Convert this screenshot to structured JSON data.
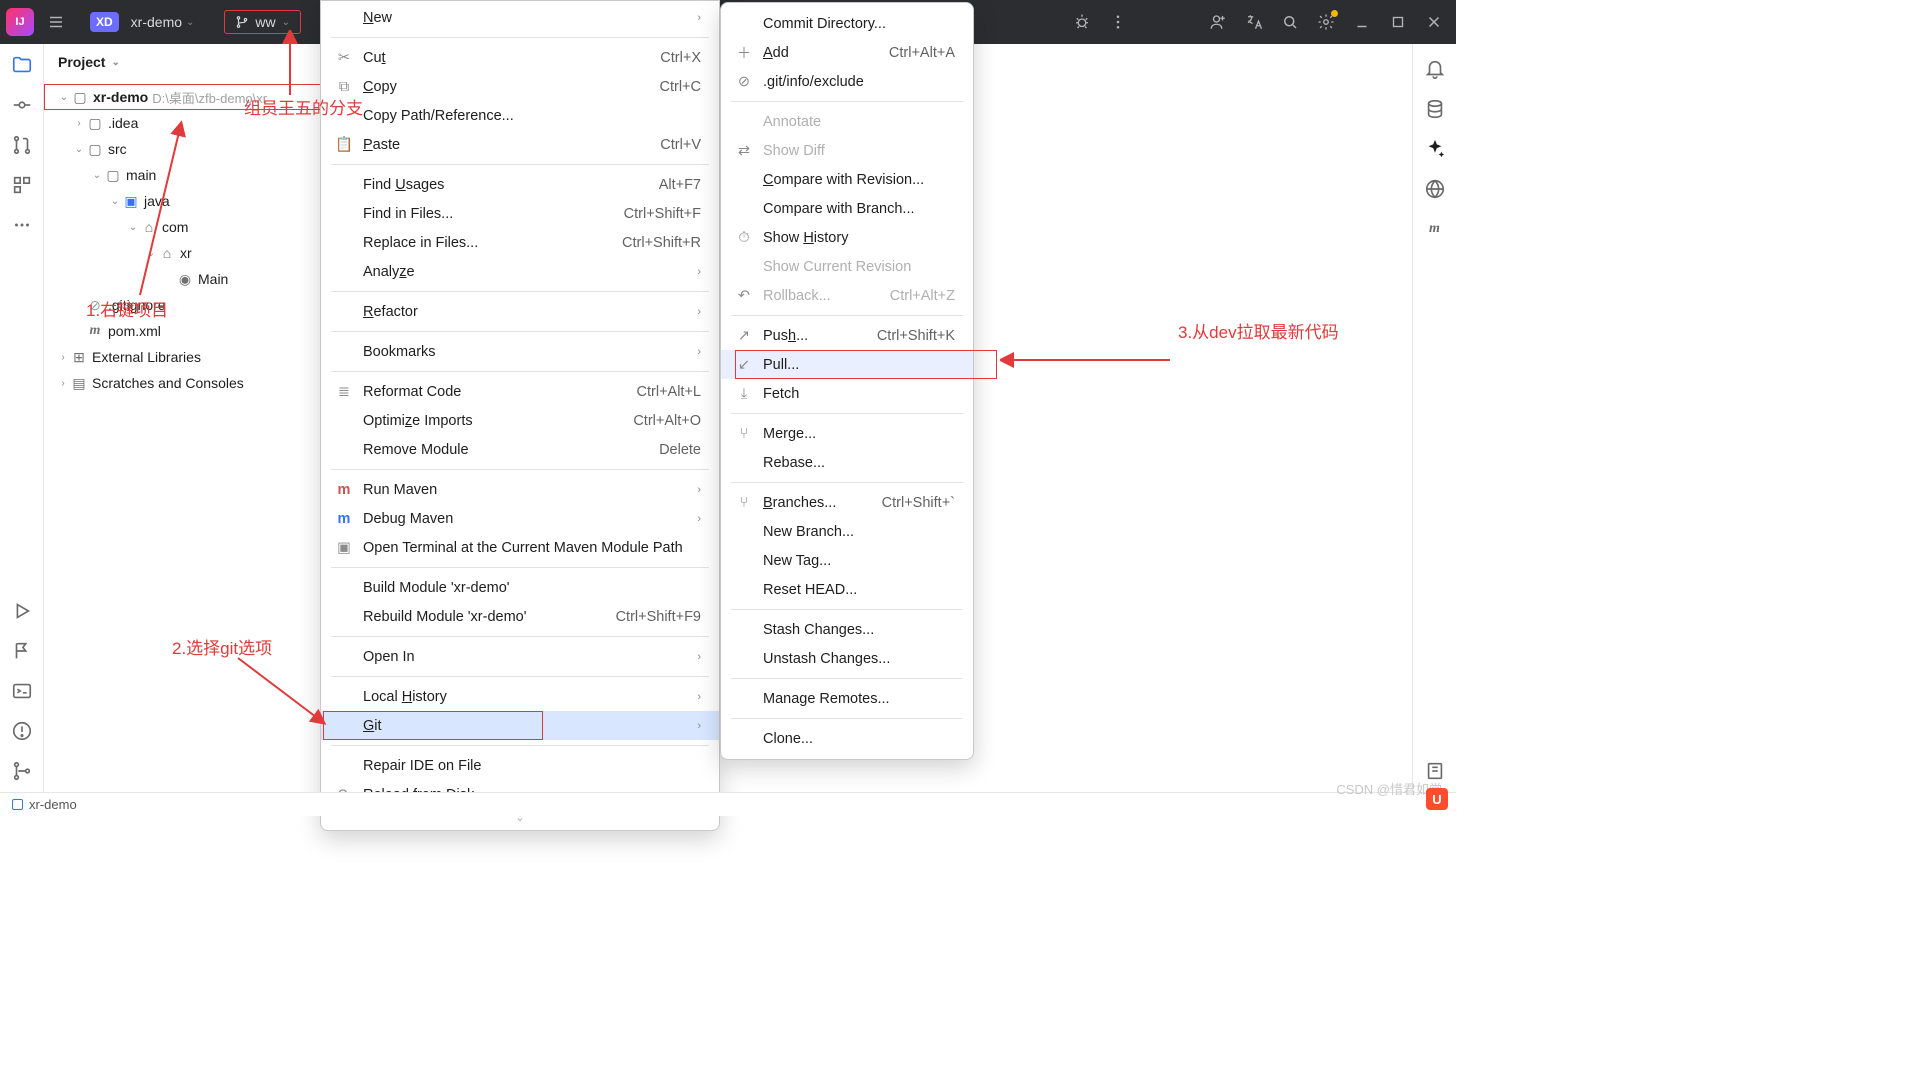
{
  "titlebar": {
    "project_badge": "XD",
    "project_name": "xr-demo",
    "branch_name": "ww"
  },
  "projpanel": {
    "title": "Project"
  },
  "tree": {
    "root": {
      "name": "xr-demo",
      "path": "D:\\桌面\\zfb-demo\\xr"
    },
    "idea": ".idea",
    "src": "src",
    "main": "main",
    "java": "java",
    "com": "com",
    "xr": "xr",
    "mainclass": "Main",
    "gitignore": ".gitignore",
    "pom": "pom.xml",
    "extlib": "External Libraries",
    "scratch": "Scratches and Consoles"
  },
  "menu1": {
    "new": "New",
    "cut": "Cut",
    "cut_s": "Ctrl+X",
    "copy": "Copy",
    "copy_s": "Ctrl+C",
    "copypath": "Copy Path/Reference...",
    "paste": "Paste",
    "paste_s": "Ctrl+V",
    "findusages": "Find Usages",
    "findusages_s": "Alt+F7",
    "findinfiles": "Find in Files...",
    "findinfiles_s": "Ctrl+Shift+F",
    "replaceinfiles": "Replace in Files...",
    "replaceinfiles_s": "Ctrl+Shift+R",
    "analyze": "Analyze",
    "refactor": "Refactor",
    "bookmarks": "Bookmarks",
    "reformat": "Reformat Code",
    "reformat_s": "Ctrl+Alt+L",
    "optimize": "Optimize Imports",
    "optimize_s": "Ctrl+Alt+O",
    "removemodule": "Remove Module",
    "removemodule_s": "Delete",
    "runmaven": "Run Maven",
    "debugmaven": "Debug Maven",
    "openterm": "Open Terminal at the Current Maven Module Path",
    "buildmod": "Build Module 'xr-demo'",
    "rebuildmod": "Rebuild Module 'xr-demo'",
    "rebuildmod_s": "Ctrl+Shift+F9",
    "openin": "Open In",
    "localhist": "Local History",
    "git": "Git",
    "repairide": "Repair IDE on File",
    "reload": "Reload from Disk"
  },
  "menu2": {
    "commitdir": "Commit Directory...",
    "add": "Add",
    "add_s": "Ctrl+Alt+A",
    "exclude": ".git/info/exclude",
    "annotate": "Annotate",
    "showdiff": "Show Diff",
    "comparewrev": "Compare with Revision...",
    "comparewbranch": "Compare with Branch...",
    "showhist": "Show History",
    "showcurrev": "Show Current Revision",
    "rollback": "Rollback...",
    "rollback_s": "Ctrl+Alt+Z",
    "push": "Push...",
    "push_s": "Ctrl+Shift+K",
    "pull": "Pull...",
    "fetch": "Fetch",
    "merge": "Merge...",
    "rebase": "Rebase...",
    "branches": "Branches...",
    "branches_s": "Ctrl+Shift+`",
    "newbranch": "New Branch...",
    "newtag": "New Tag...",
    "resethead": "Reset HEAD...",
    "stash": "Stash Changes...",
    "unstash": "Unstash Changes...",
    "remotes": "Manage Remotes...",
    "clone": "Clone..."
  },
  "status": {
    "project": "xr-demo"
  },
  "ann": {
    "a_branch": "组员王五的分支",
    "a1": "1.右键项目",
    "a2": "2.选择git选项",
    "a3": "3.从dev拉取最新代码"
  },
  "watermark": "CSDN @惜君如常"
}
